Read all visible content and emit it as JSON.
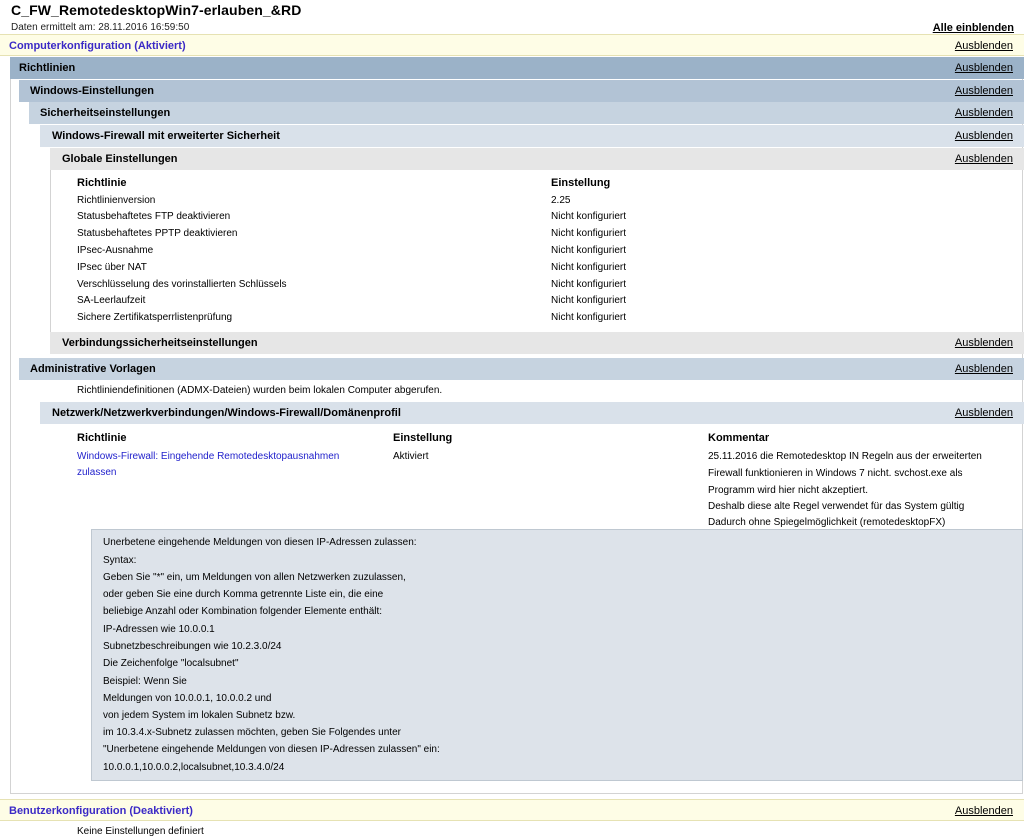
{
  "header": {
    "title": "C_FW_RemotedesktopWin7-erlauben_&RD",
    "subtitle": "Daten ermittelt am: 28.11.2016 16:59:50",
    "show_all": "Alle einblenden"
  },
  "hide_label": "Ausblenden",
  "sections": {
    "computer": "Computerkonfiguration (Aktiviert)",
    "richtlinien": "Richtlinien",
    "windows": "Windows-Einstellungen",
    "security": "Sicherheitseinstellungen",
    "firewall": "Windows-Firewall mit erweiterter Sicherheit",
    "global": "Globale Einstellungen",
    "connsec": "Verbindungssicherheitseinstellungen",
    "admin": "Administrative Vorlagen",
    "domain": "Netzwerk/Netzwerkverbindungen/Windows-Firewall/Domänenprofil",
    "user": "Benutzerkonfiguration (Deaktiviert)"
  },
  "global_table": {
    "col_policy": "Richtlinie",
    "col_setting": "Einstellung",
    "rows": [
      {
        "policy": "Richtlinienversion",
        "setting": "2.25"
      },
      {
        "policy": "Statusbehaftetes FTP deaktivieren",
        "setting": "Nicht konfiguriert"
      },
      {
        "policy": "Statusbehaftetes PPTP deaktivieren",
        "setting": "Nicht konfiguriert"
      },
      {
        "policy": "IPsec-Ausnahme",
        "setting": "Nicht konfiguriert"
      },
      {
        "policy": "IPsec über NAT",
        "setting": "Nicht konfiguriert"
      },
      {
        "policy": "Verschlüsselung des vorinstallierten Schlüssels",
        "setting": "Nicht konfiguriert"
      },
      {
        "policy": "SA-Leerlaufzeit",
        "setting": "Nicht konfiguriert"
      },
      {
        "policy": "Sichere Zertifikatsperrlistenprüfung",
        "setting": "Nicht konfiguriert"
      }
    ]
  },
  "admin_note": "Richtliniendefinitionen (ADMX-Dateien) wurden beim lokalen Computer abgerufen.",
  "domain_table": {
    "col_policy": "Richtlinie",
    "col_setting": "Einstellung",
    "col_comment": "Kommentar",
    "policy_line1": "Windows-Firewall: Eingehende Remotedesktopausnahmen",
    "policy_line2": "zulassen",
    "setting": "Aktiviert",
    "comment_lines": [
      "25.11.2016 die Remotedesktop IN Regeln aus der erweiterten",
      "Firewall funktionieren in Windows 7 nicht. svchost.exe als",
      "Programm wird hier nicht akzeptiert.",
      "Deshalb diese alte Regel verwendet für das System gültig",
      "Dadurch ohne Spiegelmöglichkeit (remotedesktopFX)"
    ]
  },
  "detail_lines": [
    "Unerbetene eingehende Meldungen von diesen IP-Adressen zulassen:",
    "Syntax:",
    "Geben Sie \"*\" ein, um Meldungen von allen Netzwerken zuzulassen,",
    "oder geben Sie eine durch Komma getrennte Liste ein, die eine",
    "beliebige Anzahl oder Kombination folgender Elemente enthält:",
    "IP-Adressen wie 10.0.0.1",
    "Subnetzbeschreibungen wie 10.2.3.0/24",
    "Die Zeichenfolge \"localsubnet\"",
    "Beispiel: Wenn Sie",
    "Meldungen von 10.0.0.1, 10.0.0.2 und",
    "von jedem System im lokalen Subnetz bzw.",
    "im 10.3.4.x-Subnetz zulassen möchten, geben Sie Folgendes unter",
    "\"Unerbetene eingehende Meldungen von diesen IP-Adressen zulassen\" ein:",
    "10.0.0.1,10.0.0.2,localsubnet,10.3.4.0/24"
  ],
  "user_note": "Keine Einstellungen definiert"
}
